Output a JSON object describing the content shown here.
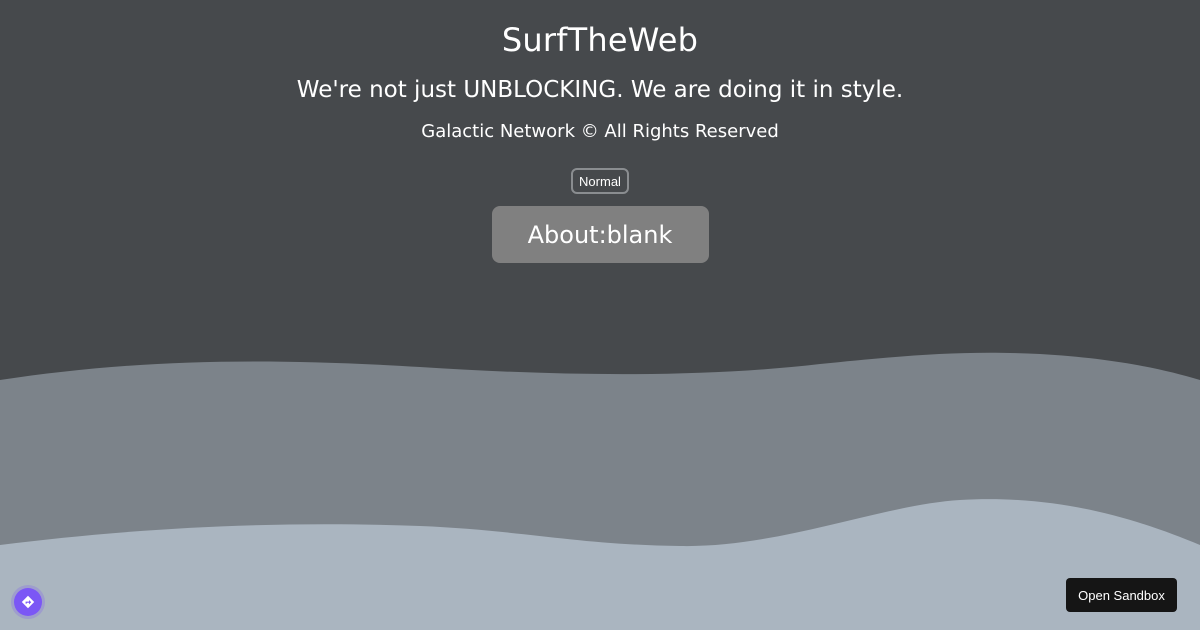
{
  "header": {
    "title": "SurfTheWeb",
    "tagline": "We're not just UNBLOCKING. We are doing it in style.",
    "copyright": "Galactic Network © All Rights Reserved"
  },
  "controls": {
    "mode_label": "Normal",
    "aboutblank_label": "About:blank"
  },
  "footer": {
    "sandbox_label": "Open Sandbox",
    "corner_icon": "diamond-arrow-icon"
  },
  "colors": {
    "background": "#46494c",
    "wave_mid": "#7c838a",
    "wave_front": "#aab5c0",
    "aboutblank_bg": "#808080",
    "sandbox_bg": "#151515",
    "badge": "#7b57f5"
  }
}
